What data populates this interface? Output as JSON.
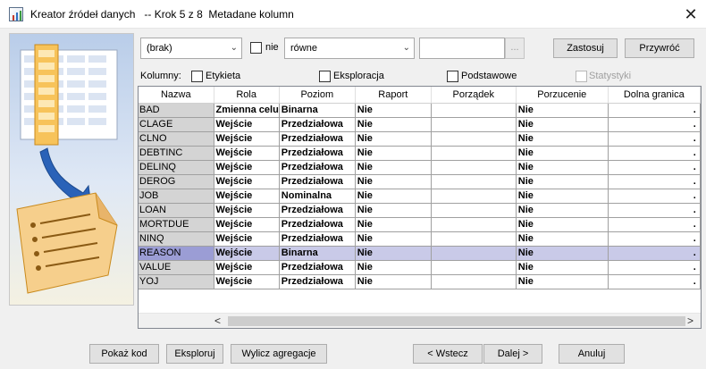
{
  "window": {
    "title": "Kreator źródeł danych   -- Krok 5 z 8  Metadane kolumn",
    "close_icon": "close-icon",
    "app_icon": "data-source-wizard-icon"
  },
  "side_panel": {
    "icon": "table-to-document-illustration"
  },
  "filter": {
    "column_select": "(brak)",
    "negate_label": "nie",
    "negate_checked": false,
    "operator_select": "równe",
    "value_input": "",
    "browse_label": "...",
    "apply_label": "Zastosuj",
    "reset_label": "Przywróć"
  },
  "columns_toggle": {
    "label": "Kolumny:",
    "options": [
      {
        "label": "Etykieta",
        "checked": false,
        "enabled": true
      },
      {
        "label": "Eksploracja",
        "checked": false,
        "enabled": true
      },
      {
        "label": "Podstawowe",
        "checked": false,
        "enabled": true
      },
      {
        "label": "Statystyki",
        "checked": false,
        "enabled": false
      }
    ]
  },
  "table": {
    "headers": [
      "Nazwa",
      "Rola",
      "Poziom",
      "Raport",
      "Porządek",
      "Porzucenie",
      "Dolna granica"
    ],
    "rows": [
      {
        "name": "BAD",
        "role": "Zmienna celu",
        "level": "Binarna",
        "report": "Nie",
        "order": "",
        "drop": "Nie",
        "lower": "."
      },
      {
        "name": "CLAGE",
        "role": "Wejście",
        "level": "Przedziałowa",
        "report": "Nie",
        "order": "",
        "drop": "Nie",
        "lower": "."
      },
      {
        "name": "CLNO",
        "role": "Wejście",
        "level": "Przedziałowa",
        "report": "Nie",
        "order": "",
        "drop": "Nie",
        "lower": "."
      },
      {
        "name": "DEBTINC",
        "role": "Wejście",
        "level": "Przedziałowa",
        "report": "Nie",
        "order": "",
        "drop": "Nie",
        "lower": "."
      },
      {
        "name": "DELINQ",
        "role": "Wejście",
        "level": "Przedziałowa",
        "report": "Nie",
        "order": "",
        "drop": "Nie",
        "lower": "."
      },
      {
        "name": "DEROG",
        "role": "Wejście",
        "level": "Przedziałowa",
        "report": "Nie",
        "order": "",
        "drop": "Nie",
        "lower": "."
      },
      {
        "name": "JOB",
        "role": "Wejście",
        "level": "Nominalna",
        "report": "Nie",
        "order": "",
        "drop": "Nie",
        "lower": "."
      },
      {
        "name": "LOAN",
        "role": "Wejście",
        "level": "Przedziałowa",
        "report": "Nie",
        "order": "",
        "drop": "Nie",
        "lower": "."
      },
      {
        "name": "MORTDUE",
        "role": "Wejście",
        "level": "Przedziałowa",
        "report": "Nie",
        "order": "",
        "drop": "Nie",
        "lower": "."
      },
      {
        "name": "NINQ",
        "role": "Wejście",
        "level": "Przedziałowa",
        "report": "Nie",
        "order": "",
        "drop": "Nie",
        "lower": "."
      },
      {
        "name": "REASON",
        "role": "Wejście",
        "level": "Binarna",
        "report": "Nie",
        "order": "",
        "drop": "Nie",
        "lower": "."
      },
      {
        "name": "VALUE",
        "role": "Wejście",
        "level": "Przedziałowa",
        "report": "Nie",
        "order": "",
        "drop": "Nie",
        "lower": "."
      },
      {
        "name": "YOJ",
        "role": "Wejście",
        "level": "Przedziałowa",
        "report": "Nie",
        "order": "",
        "drop": "Nie",
        "lower": "."
      }
    ],
    "selected_row": "REASON",
    "scroll_left_icon": "scroll-left-icon",
    "scroll_right_icon": "scroll-right-icon"
  },
  "footer": {
    "show_code_label": "Pokaż kod",
    "explore_label": "Eksploruj",
    "compute_summary_label": "Wylicz agregacje",
    "back_label": "< Wstecz",
    "next_label": "Dalej >",
    "cancel_label": "Anuluj"
  },
  "colors": {
    "selected_row": "#c9cae8",
    "selected_name_cell": "#9b9dd5",
    "name_cell": "#d4d4d4",
    "dialog_bg": "#f0f0f0"
  }
}
